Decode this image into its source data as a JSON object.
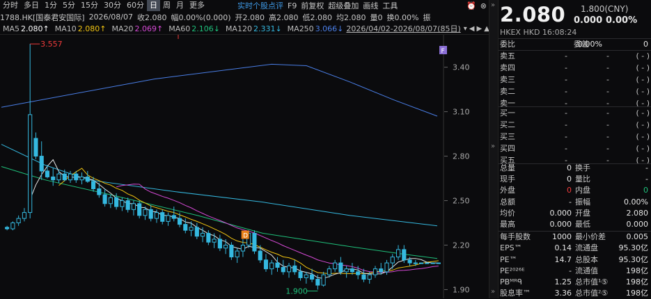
{
  "toolbar": {
    "periods": [
      "分时",
      "多日",
      "1分",
      "5分",
      "15分",
      "30分",
      "60分",
      "日",
      "周",
      "月",
      "更多"
    ],
    "active_period": "日",
    "links": [
      "实时个股点评",
      "F9",
      "前复权",
      "超级叠加",
      "画线",
      "工具"
    ],
    "icons": [
      "alarm-icon",
      "close-icon"
    ]
  },
  "info": {
    "code": "1788.HK[国泰君安国际]",
    "date": "2026/08/07",
    "close": "收2.080",
    "amp": "幅0.00%(0.000)",
    "open": "开2.080",
    "high": "高2.080",
    "low": "低2.080",
    "avg": "均2.080",
    "vol": "量0",
    "turnover": "换0.00%",
    "zhen": "振"
  },
  "ma": {
    "items": [
      {
        "label": "MA5",
        "value": "2.080↑",
        "color": "#ffffff"
      },
      {
        "label": "MA10",
        "value": "2.080↑",
        "color": "#f2c511"
      },
      {
        "label": "MA20",
        "value": "2.069↑",
        "color": "#d64ad6"
      },
      {
        "label": "MA60",
        "value": "2.106↓",
        "color": "#1fc27c"
      },
      {
        "label": "MA120",
        "value": "2.331↓",
        "color": "#35b9e0"
      },
      {
        "label": "MA250",
        "value": "3.066↓",
        "color": "#4a7fe8"
      }
    ],
    "range": "2026/04/02-2026/08/07(85日)"
  },
  "chart_data": {
    "type": "candlestick",
    "y_ticks": [
      "3.40",
      "3.10",
      "2.80",
      "2.50",
      "2.20",
      "1.90"
    ],
    "ylim": [
      1.86,
      3.6
    ],
    "annotations": {
      "high": "3.557",
      "low": "1.900",
      "f_badge": "F",
      "d_badge": "D"
    },
    "candles": [
      [
        2.32,
        2.33,
        2.3,
        2.31
      ],
      [
        2.31,
        2.36,
        2.3,
        2.35
      ],
      [
        2.35,
        2.4,
        2.33,
        2.38
      ],
      [
        2.38,
        2.45,
        2.36,
        2.42
      ],
      [
        2.42,
        3.557,
        2.38,
        3.08
      ],
      [
        2.92,
        2.96,
        2.78,
        2.8
      ],
      [
        2.8,
        2.9,
        2.64,
        2.7
      ],
      [
        2.7,
        2.74,
        2.65,
        2.66
      ],
      [
        2.66,
        2.72,
        2.6,
        2.64
      ],
      [
        2.64,
        2.7,
        2.62,
        2.68
      ],
      [
        2.68,
        2.71,
        2.63,
        2.64
      ],
      [
        2.64,
        2.7,
        2.62,
        2.68
      ],
      [
        2.68,
        2.7,
        2.62,
        2.64
      ],
      [
        2.64,
        2.69,
        2.61,
        2.66
      ],
      [
        2.66,
        2.7,
        2.62,
        2.63
      ],
      [
        2.63,
        2.66,
        2.56,
        2.58
      ],
      [
        2.58,
        2.62,
        2.52,
        2.54
      ],
      [
        2.54,
        2.58,
        2.46,
        2.48
      ],
      [
        2.48,
        2.54,
        2.45,
        2.52
      ],
      [
        2.52,
        2.55,
        2.44,
        2.46
      ],
      [
        2.46,
        2.52,
        2.43,
        2.5
      ],
      [
        2.5,
        2.52,
        2.42,
        2.44
      ],
      [
        2.44,
        2.5,
        2.4,
        2.48
      ],
      [
        2.48,
        2.5,
        2.38,
        2.4
      ],
      [
        2.4,
        2.46,
        2.37,
        2.44
      ],
      [
        2.44,
        2.47,
        2.36,
        2.38
      ],
      [
        2.38,
        2.44,
        2.35,
        2.42
      ],
      [
        2.42,
        2.44,
        2.34,
        2.36
      ],
      [
        2.36,
        2.42,
        2.33,
        2.4
      ],
      [
        2.4,
        2.46,
        2.36,
        2.38
      ],
      [
        2.38,
        2.42,
        2.32,
        2.34
      ],
      [
        2.34,
        2.38,
        2.28,
        2.3
      ],
      [
        2.3,
        2.36,
        2.26,
        2.32
      ],
      [
        2.32,
        2.35,
        2.24,
        2.26
      ],
      [
        2.26,
        2.32,
        2.22,
        2.28
      ],
      [
        2.28,
        2.3,
        2.2,
        2.22
      ],
      [
        2.22,
        2.28,
        2.18,
        2.24
      ],
      [
        2.24,
        2.27,
        2.16,
        2.18
      ],
      [
        2.18,
        2.24,
        2.14,
        2.2
      ],
      [
        2.2,
        2.22,
        2.1,
        2.12
      ],
      [
        2.12,
        2.18,
        2.08,
        2.16
      ],
      [
        2.16,
        2.24,
        2.12,
        2.2
      ],
      [
        2.2,
        2.3,
        2.18,
        2.28
      ],
      [
        2.28,
        2.3,
        2.14,
        2.16
      ],
      [
        2.16,
        2.2,
        2.08,
        2.1
      ],
      [
        2.1,
        2.14,
        2.02,
        2.04
      ],
      [
        2.04,
        2.1,
        2.0,
        2.08
      ],
      [
        2.08,
        2.12,
        2.02,
        2.05
      ],
      [
        2.05,
        2.1,
        2.0,
        2.02
      ],
      [
        2.02,
        2.08,
        1.98,
        2.06
      ],
      [
        2.06,
        2.1,
        2.0,
        2.02
      ],
      [
        2.02,
        2.06,
        1.96,
        1.98
      ],
      [
        1.98,
        2.02,
        1.94,
        2.0
      ],
      [
        2.0,
        2.04,
        1.95,
        1.97
      ],
      [
        1.97,
        2.0,
        1.9,
        1.93
      ],
      [
        1.93,
        2.02,
        1.92,
        2.0
      ],
      [
        2.0,
        2.06,
        1.98,
        2.04
      ],
      [
        2.04,
        2.1,
        2.02,
        2.08
      ],
      [
        2.08,
        2.12,
        2.0,
        2.02
      ],
      [
        2.02,
        2.06,
        1.98,
        2.04
      ],
      [
        2.04,
        2.08,
        2.0,
        2.02
      ],
      [
        2.02,
        2.06,
        1.97,
        2.0
      ],
      [
        2.0,
        2.04,
        1.95,
        1.97
      ],
      [
        1.97,
        2.02,
        1.94,
        2.0
      ],
      [
        2.0,
        2.06,
        1.98,
        2.04
      ],
      [
        2.04,
        2.08,
        2.0,
        2.02
      ],
      [
        2.02,
        2.1,
        2.0,
        2.08
      ],
      [
        2.08,
        2.14,
        2.04,
        2.12
      ],
      [
        2.12,
        2.2,
        2.1,
        2.17
      ],
      [
        2.17,
        2.2,
        2.08,
        2.1
      ],
      [
        2.1,
        2.12,
        2.06,
        2.08
      ],
      [
        2.08,
        2.1,
        2.06,
        2.08
      ],
      [
        2.08,
        2.08,
        2.08,
        2.08
      ],
      [
        2.08,
        2.08,
        2.08,
        2.08
      ],
      [
        2.08,
        2.08,
        2.08,
        2.08
      ],
      [
        2.08,
        2.08,
        2.08,
        2.08
      ]
    ],
    "ma250": [
      [
        0,
        3.13
      ],
      [
        0.35,
        3.32
      ],
      [
        0.62,
        3.42
      ],
      [
        0.7,
        3.41
      ],
      [
        0.8,
        3.3
      ],
      [
        0.9,
        3.18
      ],
      [
        1.0,
        3.07
      ]
    ],
    "ma120": [
      [
        0,
        2.88
      ],
      [
        0.1,
        2.74
      ],
      [
        0.2,
        2.64
      ],
      [
        0.4,
        2.56
      ],
      [
        0.6,
        2.49
      ],
      [
        0.8,
        2.4
      ],
      [
        1.0,
        2.33
      ]
    ],
    "ma60": [
      [
        0,
        2.73
      ],
      [
        0.1,
        2.64
      ],
      [
        0.25,
        2.54
      ],
      [
        0.45,
        2.4
      ],
      [
        0.6,
        2.28
      ],
      [
        0.8,
        2.19
      ],
      [
        0.92,
        2.14
      ],
      [
        1.0,
        2.11
      ]
    ]
  },
  "quote": {
    "price": "2.080",
    "ref": "1.800(CNY)",
    "chg": "0.000",
    "chg_pct": "0.00%",
    "exchange": "HKEX  HKD  16:08:24"
  },
  "book": {
    "weibi_label": "委比",
    "weibi_val": "0.00%",
    "weicha_label": "委差",
    "weicha_val": "0",
    "asks": [
      {
        "label": "卖五",
        "price": "-",
        "vol": "-",
        "count": "(     -     )"
      },
      {
        "label": "卖四",
        "price": "-",
        "vol": "-",
        "count": "(     -     )"
      },
      {
        "label": "卖三",
        "price": "-",
        "vol": "-",
        "count": "(     -     )"
      },
      {
        "label": "卖二",
        "price": "-",
        "vol": "-",
        "count": "(     -     )"
      },
      {
        "label": "卖一",
        "price": "-",
        "vol": "-",
        "count": "(     -     )"
      }
    ],
    "bids": [
      {
        "label": "买一",
        "price": "-",
        "vol": "-",
        "count": "(     -     )"
      },
      {
        "label": "买二",
        "price": "-",
        "vol": "-",
        "count": "(     -     )"
      },
      {
        "label": "买三",
        "price": "-",
        "vol": "-",
        "count": "(     -     )"
      },
      {
        "label": "买四",
        "price": "-",
        "vol": "-",
        "count": "(     -     )"
      },
      {
        "label": "买五",
        "price": "-",
        "vol": "-",
        "count": "(     -     )"
      }
    ]
  },
  "stats": [
    {
      "l1": "总量",
      "v1": "0",
      "l2": "换手",
      "v2": "-",
      "c1": "white",
      "c2": "white"
    },
    {
      "l1": "现手",
      "v1": "0",
      "l2": "量比",
      "v2": "-",
      "c1": "white",
      "c2": "white"
    },
    {
      "l1": "外盘",
      "v1": "0",
      "l2": "内盘",
      "v2": "0",
      "c1": "red",
      "c2": "green"
    },
    {
      "l1": "总额",
      "v1": "-",
      "l2": "振幅",
      "v2": "0.00%",
      "c1": "white",
      "c2": "white"
    },
    {
      "l1": "均价",
      "v1": "0.000",
      "l2": "开盘",
      "v2": "2.080",
      "c1": "white",
      "c2": "white"
    },
    {
      "l1": "最高",
      "v1": "0.000",
      "l2": "最低",
      "v2": "0.000",
      "c1": "white",
      "c2": "white"
    },
    {
      "l1": "每手股数",
      "v1": "1000",
      "l2": "最小价差",
      "v2": "0.005",
      "c1": "white",
      "c2": "white"
    },
    {
      "l1": "EPS™",
      "v1": "0.14",
      "l2": "流通盘",
      "v2": "95.30亿",
      "c1": "white",
      "c2": "white"
    },
    {
      "l1": "PE™",
      "v1": "14.7",
      "l2": "总股本",
      "v2": "95.30亿",
      "c1": "white",
      "c2": "white"
    },
    {
      "l1": "PE²⁰²⁶ᴱ",
      "v1": "-",
      "l2": "流通值",
      "v2": "198亿",
      "c1": "white",
      "c2": "white"
    },
    {
      "l1": "PBᴹᴿᑫ",
      "v1": "1.25",
      "l2": "总市值¹⑤",
      "v2": "198亿",
      "c1": "white",
      "c2": "white"
    },
    {
      "l1": "股息率™",
      "v1": "3.36",
      "l2": "总市值²⑤",
      "v2": "198亿",
      "c1": "white",
      "c2": "white"
    }
  ],
  "divider_arrows": [
    "»",
    "»",
    "»"
  ]
}
